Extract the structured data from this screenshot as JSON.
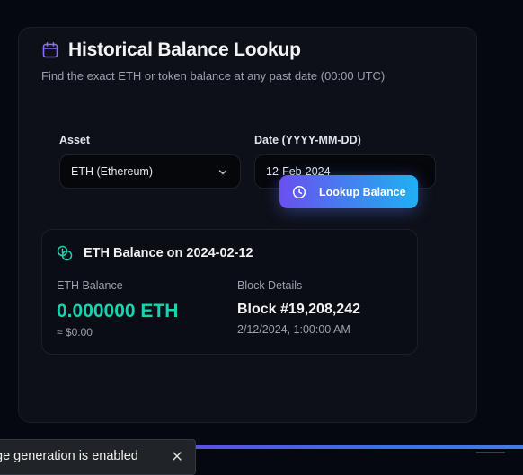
{
  "header": {
    "title": "Historical Balance Lookup",
    "subtitle": "Find the exact ETH or token balance at any past date (00:00 UTC)",
    "icon": "calendar-icon"
  },
  "form": {
    "asset_label": "Asset",
    "asset_value": "ETH (Ethereum)",
    "date_label": "Date (YYYY-MM-DD)",
    "date_value": "12-Feb-2024"
  },
  "lookup_button": {
    "label": "Lookup Balance",
    "icon": "clock-icon"
  },
  "result": {
    "icon": "coins-icon",
    "title": "ETH Balance on 2024-02-12",
    "balance_label": "ETH Balance",
    "balance_value": "0.000000 ETH",
    "usd_value": "≈ $0.00",
    "block_label": "Block Details",
    "block_number": "Block #19,208,242",
    "block_time": "2/12/2024, 1:00:00 AM"
  },
  "toast": {
    "text": "ge generation is enabled",
    "close_icon": "close-icon"
  },
  "colors": {
    "accent_purple": "#7b61ff",
    "accent_teal": "#17d3b0",
    "button_gradient_start": "#6a4ff0",
    "button_gradient_end": "#1fb0f2"
  }
}
